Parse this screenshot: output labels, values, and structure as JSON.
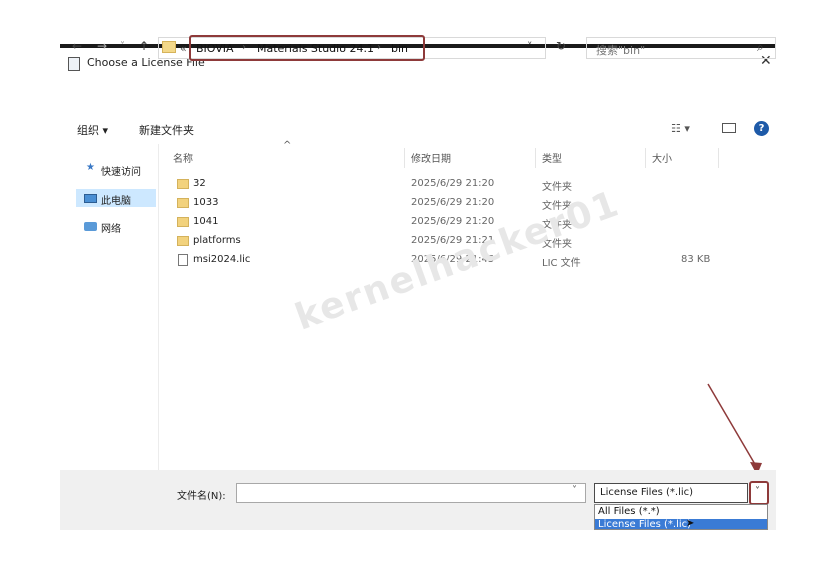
{
  "dialog": {
    "title": "Choose a License File",
    "close_glyph": "✕"
  },
  "nav": {
    "back": "←",
    "forward": "→",
    "history": "˅",
    "up": "↑",
    "overflow": "«",
    "breadcrumbs": [
      "BIOVIA",
      "Materials Studio 24.1",
      "bin"
    ],
    "separator": "›",
    "dropdown": "˅",
    "refresh": "↻",
    "search_placeholder": "搜索\"bin\"",
    "search_icon": "⌕"
  },
  "toolbar": {
    "organize": "组织 ▾",
    "new_folder": "新建文件夹",
    "view_glyph": "☷ ▾",
    "help": "?"
  },
  "sidebar": {
    "items": [
      {
        "label": "快速访问",
        "icon": "star-icon"
      },
      {
        "label": "此电脑",
        "icon": "pc-icon"
      },
      {
        "label": "网络",
        "icon": "network-icon"
      }
    ]
  },
  "columns": {
    "name": "名称",
    "modified": "修改日期",
    "type": "类型",
    "size": "大小",
    "sort_glyph": "^"
  },
  "files": [
    {
      "name": "32",
      "date": "2025/6/29 21:20",
      "type": "文件夹",
      "size": "",
      "kind": "folder"
    },
    {
      "name": "1033",
      "date": "2025/6/29 21:20",
      "type": "文件夹",
      "size": "",
      "kind": "folder"
    },
    {
      "name": "1041",
      "date": "2025/6/29 21:20",
      "type": "文件夹",
      "size": "",
      "kind": "folder"
    },
    {
      "name": "platforms",
      "date": "2025/6/29 21:21",
      "type": "文件夹",
      "size": "",
      "kind": "folder"
    },
    {
      "name": "msi2024.lic",
      "date": "2025/6/29 21:45",
      "type": "LIC 文件",
      "size": "83 KB",
      "kind": "file"
    }
  ],
  "watermark": "kernelhacker01",
  "footer": {
    "filename_label": "文件名(N):",
    "filename_value": "",
    "filename_dropdown": "˅",
    "filter_selected": "License Files (*.lic)",
    "filter_dropdown": "˅",
    "options": [
      "All Files (*.*)",
      "License Files (*.lic)"
    ]
  },
  "colors": {
    "annotation": "#8e3a3a",
    "selection": "#3a7bd5"
  }
}
